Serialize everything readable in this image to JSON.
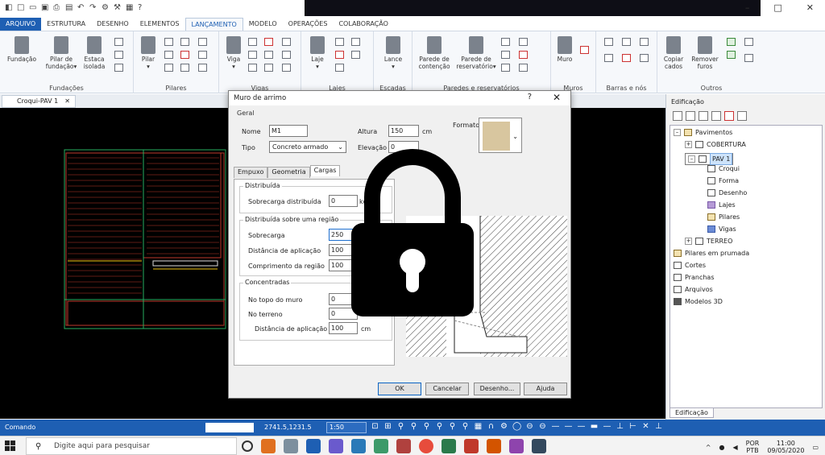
{
  "quick_access": {
    "icons": [
      "app-icon",
      "new-icon",
      "open-icon",
      "save-icon",
      "print-icon",
      "save-all-icon",
      "undo-icon",
      "redo-icon",
      "tool-icon",
      "tool-icon",
      "tool-icon",
      "help-icon"
    ]
  },
  "window": {
    "minimize": "–",
    "maximize": "□",
    "close": "✕"
  },
  "ribbon_tabs": [
    "ARQUIVO",
    "ESTRUTURA",
    "DESENHO",
    "ELEMENTOS",
    "LANÇAMENTO",
    "MODELO",
    "OPERAÇÕES",
    "COLABORAÇÃO"
  ],
  "ribbon": {
    "groups": [
      {
        "label": "Fundações",
        "buttons": [
          "Fundação",
          "Pilar de\nfundação▾",
          "Estaca\nisolada"
        ]
      },
      {
        "label": "Pilares",
        "buttons": [
          "Pilar\n▾"
        ]
      },
      {
        "label": "Vigas",
        "buttons": [
          "Viga\n▾"
        ]
      },
      {
        "label": "Lajes",
        "buttons": [
          "Laje\n▾"
        ]
      },
      {
        "label": "Escadas",
        "buttons": [
          "Lance\n▾"
        ]
      },
      {
        "label": "Paredes e reservatórios",
        "buttons": [
          "Parede de\ncontenção",
          "Parede de\nreservatório▾"
        ]
      },
      {
        "label": "Muros",
        "buttons": [
          "Muro"
        ]
      },
      {
        "label": "Barras e nós",
        "buttons": []
      },
      {
        "label": "Outros",
        "buttons": [
          "Copiar\ncados",
          "Remover\nfuros"
        ]
      }
    ]
  },
  "doc_tab": {
    "label": "Croqui-PAV 1",
    "close": "✕"
  },
  "dialog": {
    "title": "Muro de arrimo",
    "help": "?",
    "close": "✕",
    "geral_label": "Geral",
    "nome_label": "Nome",
    "nome_value": "M1",
    "altura_label": "Altura",
    "altura_value": "150",
    "altura_unit": "cm",
    "tipo_label": "Tipo",
    "tipo_value": "Concreto armado",
    "elevacao_label": "Elevação",
    "elevacao_value": "0",
    "formato_label": "Formato",
    "tabs": [
      "Empuxo",
      "Geometria",
      "Cargas"
    ],
    "distribuida": {
      "title": "Distribuída",
      "sobrecarga_label": "Sobrecarga distribuída",
      "sobrecarga_value": "0",
      "unit": "kg"
    },
    "regiao": {
      "title": "Distribuída sobre uma região",
      "sobrecarga_label": "Sobrecarga",
      "sobrecarga_value": "250",
      "distancia_label": "Distância de aplicação",
      "distancia_value": "100",
      "comprimento_label": "Comprimento da região",
      "comprimento_value": "100"
    },
    "concentradas": {
      "title": "Concentradas",
      "topo_label": "No topo do muro",
      "topo_value": "0",
      "terreno_label": "No terreno",
      "terreno_value": "0",
      "distancia_label": "Distância de aplicação",
      "distancia_value": "100",
      "unit": "cm"
    },
    "buttons": {
      "ok": "OK",
      "cancel": "Cancelar",
      "desenho": "Desenho...",
      "ajuda": "Ajuda"
    }
  },
  "panel": {
    "title": "Edificação",
    "tree": [
      {
        "label": "Pavimentos",
        "level": 0
      },
      {
        "label": "COBERTURA",
        "level": 1
      },
      {
        "label": "PAV 1",
        "level": 1,
        "selected": true
      },
      {
        "label": "Croqui",
        "level": 2
      },
      {
        "label": "Forma",
        "level": 2
      },
      {
        "label": "Desenho",
        "level": 2
      },
      {
        "label": "Lajes",
        "level": 2
      },
      {
        "label": "Pilares",
        "level": 2
      },
      {
        "label": "Vigas",
        "level": 2
      },
      {
        "label": "TERREO",
        "level": 1
      },
      {
        "label": "Pilares em prumada",
        "level": 0
      },
      {
        "label": "Cortes",
        "level": 0
      },
      {
        "label": "Pranchas",
        "level": 0
      },
      {
        "label": "Arquivos",
        "level": 0
      },
      {
        "label": "Modelos 3D",
        "level": 0
      }
    ],
    "footer_tab": "Edificação"
  },
  "status": {
    "label": "Comando",
    "coords": "2741.5,1231.5",
    "scale": "1:50"
  },
  "taskbar": {
    "search_placeholder": "Digite aqui para pesquisar",
    "lang": "POR",
    "layout": "PTB",
    "time": "11:00",
    "date": "09/05/2020"
  },
  "colors": {
    "accent": "#1e5fb3",
    "canvas": "#000000",
    "drawing_red": "#c0392b",
    "drawing_green": "#27ae60",
    "drawing_yellow": "#f1c40f"
  }
}
